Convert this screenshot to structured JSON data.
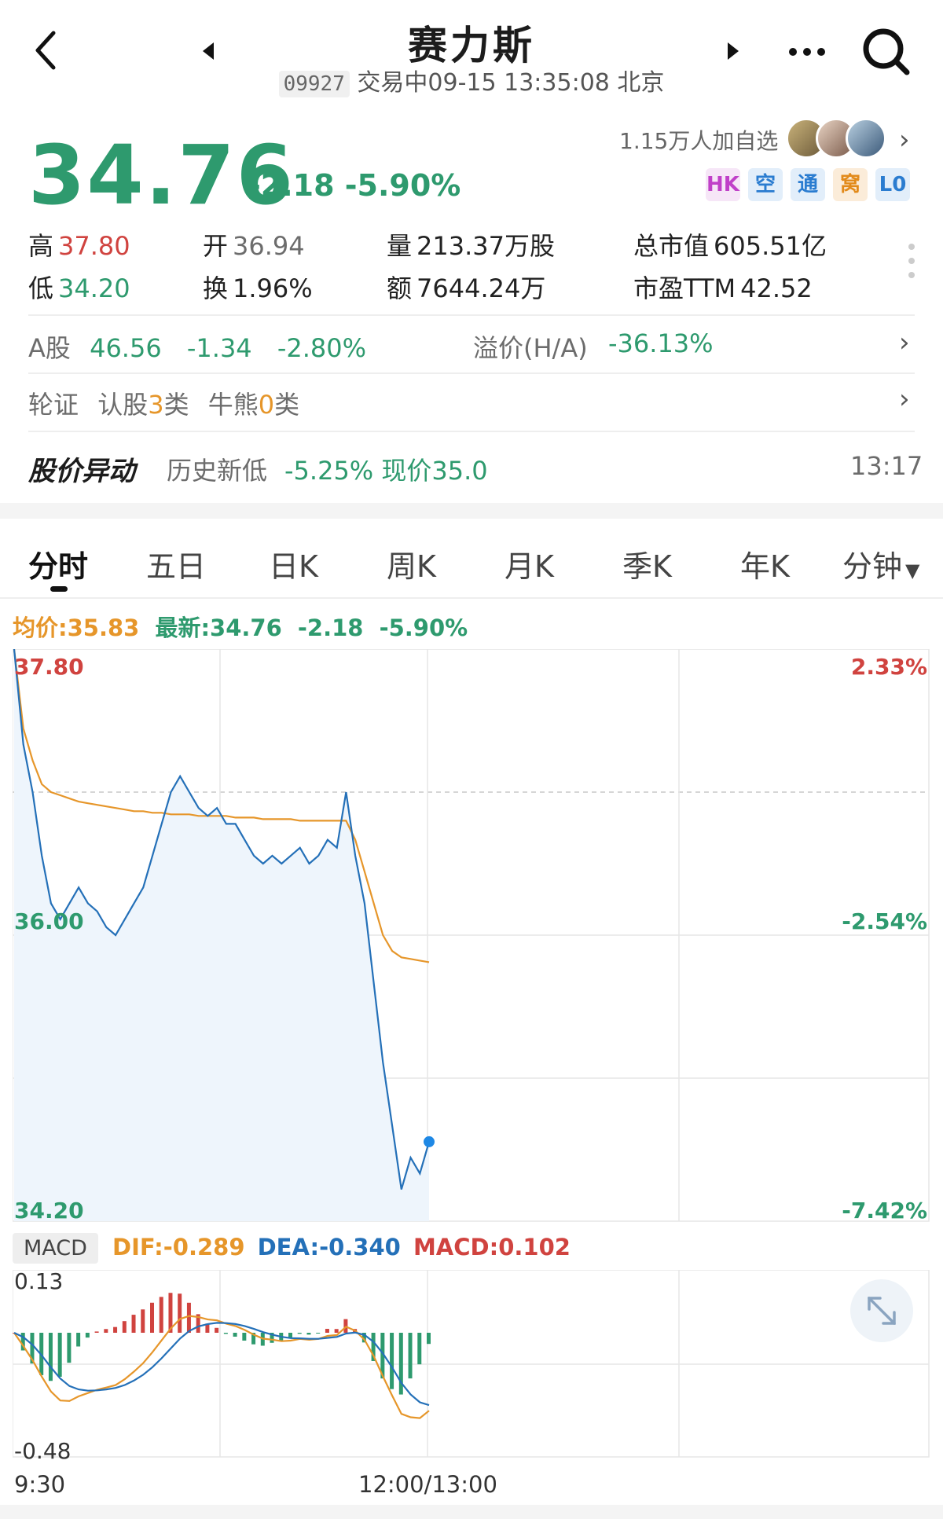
{
  "header": {
    "title": "赛力斯",
    "code": "09927",
    "status": "交易中",
    "datetime": "09-15 13:35:08 北京"
  },
  "quote": {
    "price": "34.76",
    "change": "-2.18",
    "change_pct": "-5.90%",
    "watch_count": "1.15万人加自选",
    "badges": [
      "HK",
      "空",
      "通",
      "窝",
      "L0"
    ]
  },
  "stats": {
    "high_label": "高",
    "high": "37.80",
    "low_label": "低",
    "low": "34.20",
    "open_label": "开",
    "open": "36.94",
    "turnover_label": "换",
    "turnover": "1.96%",
    "volume_label": "量",
    "volume": "213.37万股",
    "amount_label": "额",
    "amount": "7644.24万",
    "mktcap_label": "总市值",
    "mktcap": "605.51亿",
    "pe_label": "市盈TTM",
    "pe": "42.52"
  },
  "a_share": {
    "label": "A股",
    "price": "46.56",
    "change": "-1.34",
    "change_pct": "-2.80%",
    "premium_label": "溢价(H/A)",
    "premium": "-36.13%"
  },
  "warrants": {
    "label": "轮证",
    "call_label": "认股",
    "call_count": "3",
    "call_suffix": "类",
    "cbbc_label": "牛熊",
    "cbbc_count": "0",
    "cbbc_suffix": "类"
  },
  "alert": {
    "title": "股价异动",
    "text_prefix": "历史新低",
    "text_value": "-5.25% 现价35.0",
    "time": "13:17"
  },
  "tabs": [
    "分时",
    "五日",
    "日K",
    "周K",
    "月K",
    "季K",
    "年K",
    "分钟"
  ],
  "legend": {
    "avg": "均价:35.83",
    "latest": "最新:34.76",
    "change": "-2.18",
    "change_pct": "-5.90%"
  },
  "axis": {
    "price_top": "37.80",
    "price_mid": "36.00",
    "price_bottom": "34.20",
    "pct_top": "2.33%",
    "pct_mid": "-2.54%",
    "pct_bottom": "-7.42%",
    "time_start": "9:30",
    "time_mid": "12:00/13:00"
  },
  "macd": {
    "tag": "MACD",
    "dif": "DIF:-0.289",
    "dea": "DEA:-0.340",
    "macd": "MACD:0.102",
    "top": "0.13",
    "bottom": "-0.48"
  },
  "chart_data": {
    "type": "line",
    "ylim": [
      34.2,
      37.8
    ],
    "grid": true,
    "series": [
      {
        "name": "最新",
        "color": "#2470b8",
        "values": [
          37.8,
          37.2,
          36.9,
          36.5,
          36.2,
          36.1,
          36.2,
          36.3,
          36.2,
          36.15,
          36.05,
          36.0,
          36.1,
          36.2,
          36.3,
          36.5,
          36.7,
          36.9,
          37.0,
          36.9,
          36.8,
          36.75,
          36.8,
          36.7,
          36.7,
          36.6,
          36.5,
          36.45,
          36.5,
          36.45,
          36.5,
          36.55,
          36.45,
          36.5,
          36.6,
          36.55,
          36.9,
          36.5,
          36.2,
          35.7,
          35.2,
          34.8,
          34.4,
          34.6,
          34.5,
          34.7
        ]
      },
      {
        "name": "均价",
        "color": "#e6962a",
        "values": [
          37.8,
          37.3,
          37.1,
          36.95,
          36.9,
          36.88,
          36.86,
          36.84,
          36.83,
          36.82,
          36.81,
          36.8,
          36.79,
          36.78,
          36.78,
          36.77,
          36.77,
          36.76,
          36.76,
          36.76,
          36.75,
          36.75,
          36.75,
          36.75,
          36.74,
          36.74,
          36.74,
          36.73,
          36.73,
          36.73,
          36.73,
          36.72,
          36.72,
          36.72,
          36.72,
          36.72,
          36.72,
          36.6,
          36.4,
          36.2,
          36.0,
          35.9,
          35.86,
          35.85,
          35.84,
          35.83
        ]
      }
    ]
  },
  "colors": {
    "up": "#d0433f",
    "down": "#2e9a6e",
    "price_line": "#2470b8",
    "avg_line": "#e6962a"
  }
}
